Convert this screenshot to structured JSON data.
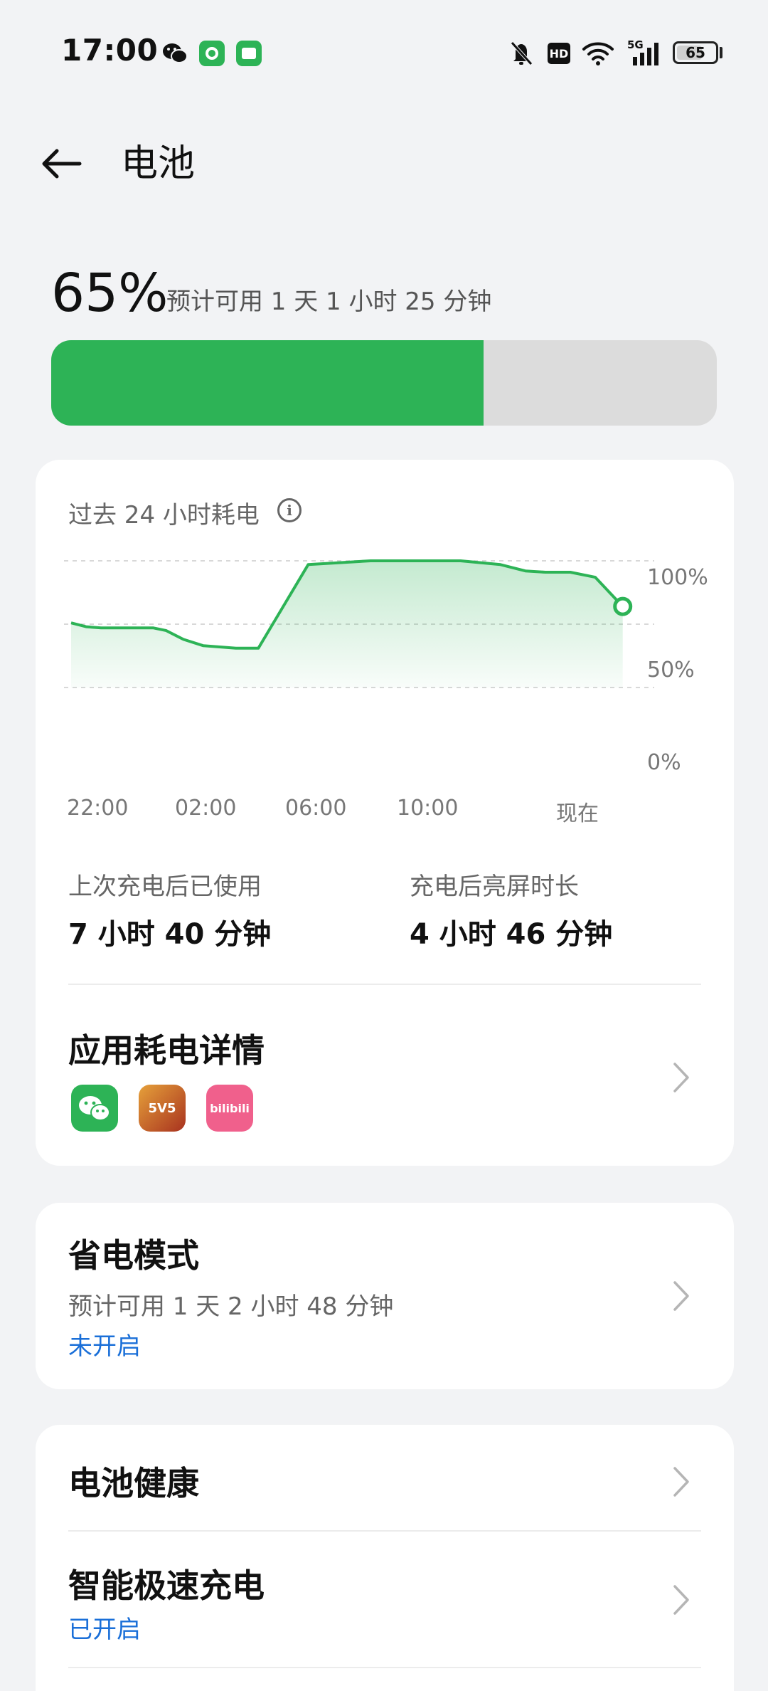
{
  "status_bar": {
    "time": "17:00",
    "network_label": "5G",
    "hd_label": "HD",
    "battery_level": "65",
    "icons": [
      "wechat-icon",
      "app-chip-icon",
      "app-chip-icon",
      "mute-bell-icon",
      "hd-icon",
      "wifi-icon",
      "signal-icon",
      "battery-icon"
    ]
  },
  "header": {
    "title": "电池",
    "back_icon": "arrow-left-icon"
  },
  "summary": {
    "percent": "65%",
    "estimate": "预计可用 1 天 1 小时 25 分钟",
    "level_fraction": 0.65,
    "fill_color": "#2db356",
    "track_color": "#dcdcdc"
  },
  "usage_card": {
    "label": "过去 24 小时耗电",
    "info_icon": "info-icon",
    "stats": [
      {
        "label": "上次充电后已使用",
        "value": "7 小时 40 分钟"
      },
      {
        "label": "充电后亮屏时长",
        "value": "4 小时 46 分钟"
      }
    ],
    "app_usage_title": "应用耗电详情",
    "apps": [
      {
        "name": "wechat-icon",
        "label": ""
      },
      {
        "name": "game-icon",
        "label": "5V5"
      },
      {
        "name": "bilibili-icon",
        "label": "bilibili"
      }
    ]
  },
  "chart_data": {
    "type": "area",
    "x_ticks": [
      "22:00",
      "02:00",
      "06:00",
      "10:00",
      "现在"
    ],
    "y_ticks": [
      "100%",
      "50%",
      "0%"
    ],
    "ylim": [
      0,
      100
    ],
    "grid": true,
    "series": [
      {
        "color": "#2db356",
        "x": [
          0,
          0.6,
          1.2,
          2,
          3.3,
          3.8,
          4.5,
          5.3,
          6.6,
          7.0,
          7.5,
          9.5,
          12.0,
          13.2,
          13.8,
          14.6,
          15.6,
          17.2,
          18.2,
          19.0,
          20.0,
          21.0,
          22.1
        ],
        "values": [
          51,
          48,
          47,
          47,
          47,
          45,
          38,
          33,
          31,
          31,
          31,
          97,
          100,
          100,
          100,
          100,
          100,
          97,
          92,
          91,
          91,
          87,
          64
        ]
      }
    ]
  },
  "power_saving": {
    "title": "省电模式",
    "estimate": "预计可用 1 天 2 小时 48 分钟",
    "status": "未开启"
  },
  "health_card": {
    "items": [
      {
        "title": "电池健康",
        "status": ""
      },
      {
        "title": "智能极速充电",
        "status": "已开启"
      }
    ]
  },
  "colors": {
    "accent_green": "#2db356",
    "status_blue": "#1a6fd8",
    "background": "#f2f3f5"
  }
}
